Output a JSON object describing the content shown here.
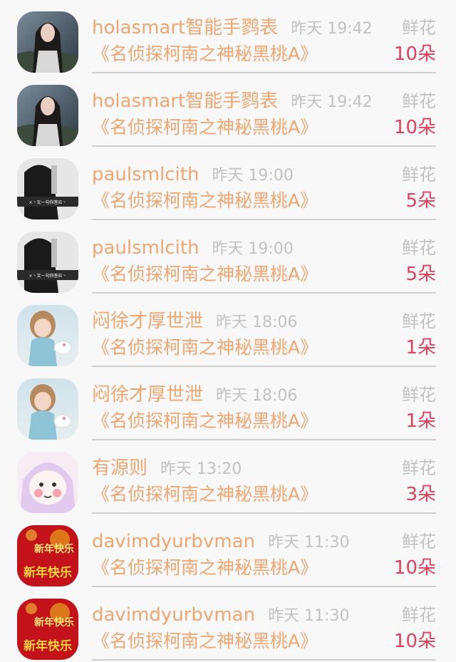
{
  "gift_records": [
    {
      "avatar": "girl-dark-hair-avatar",
      "name": "holasmart智能手鹨表",
      "time": "昨天 19:42",
      "gift": "鲜花",
      "product": "《名侦探柯南之神秘黑桃A》",
      "count": "10朵"
    },
    {
      "avatar": "girl-dark-hair-avatar",
      "name": "holasmart智能手鹨表",
      "time": "昨天 19:42",
      "gift": "鲜花",
      "product": "《名侦探柯南之神秘黑桃A》",
      "count": "10朵"
    },
    {
      "avatar": "monochrome-person-avatar",
      "name": "paulsmlcith",
      "time": "昨天 19:00",
      "gift": "鲜花",
      "product": "《名侦探柯南之神秘黑桃A》",
      "count": "5朵"
    },
    {
      "avatar": "monochrome-person-avatar",
      "name": "paulsmlcith",
      "time": "昨天 19:00",
      "gift": "鲜花",
      "product": "《名侦探柯南之神秘黑桃A》",
      "count": "5朵"
    },
    {
      "avatar": "little-girl-teapot-avatar",
      "name": "闷徐才厚世泄",
      "time": "昨天 18:06",
      "gift": "鲜花",
      "product": "《名侦探柯南之神秘黑桃A》",
      "count": "1朵"
    },
    {
      "avatar": "little-girl-teapot-avatar",
      "name": "闷徐才厚世泄",
      "time": "昨天 18:06",
      "gift": "鲜花",
      "product": "《名侦探柯南之神秘黑桃A》",
      "count": "1朵"
    },
    {
      "avatar": "anime-girl-avatar",
      "name": "有源则",
      "time": "昨天 13:20",
      "gift": "鲜花",
      "product": "《名侦探柯南之神秘黑桃A》",
      "count": "3朵"
    },
    {
      "avatar": "new-year-red-avatar",
      "name": "davimdyurbvman",
      "time": "昨天 11:30",
      "gift": "鲜花",
      "product": "《名侦探柯南之神秘黑桃A》",
      "count": "10朵"
    },
    {
      "avatar": "new-year-red-avatar",
      "name": "davimdyurbvman",
      "time": "昨天 11:30",
      "gift": "鲜花",
      "product": "《名侦探柯南之神秘黑桃A》",
      "count": "10朵"
    }
  ],
  "avatar_texts": {
    "monochrome": "×丶又一句你答应丶",
    "new_year_top": "新年快乐",
    "new_year_bottom": "新年快乐"
  }
}
